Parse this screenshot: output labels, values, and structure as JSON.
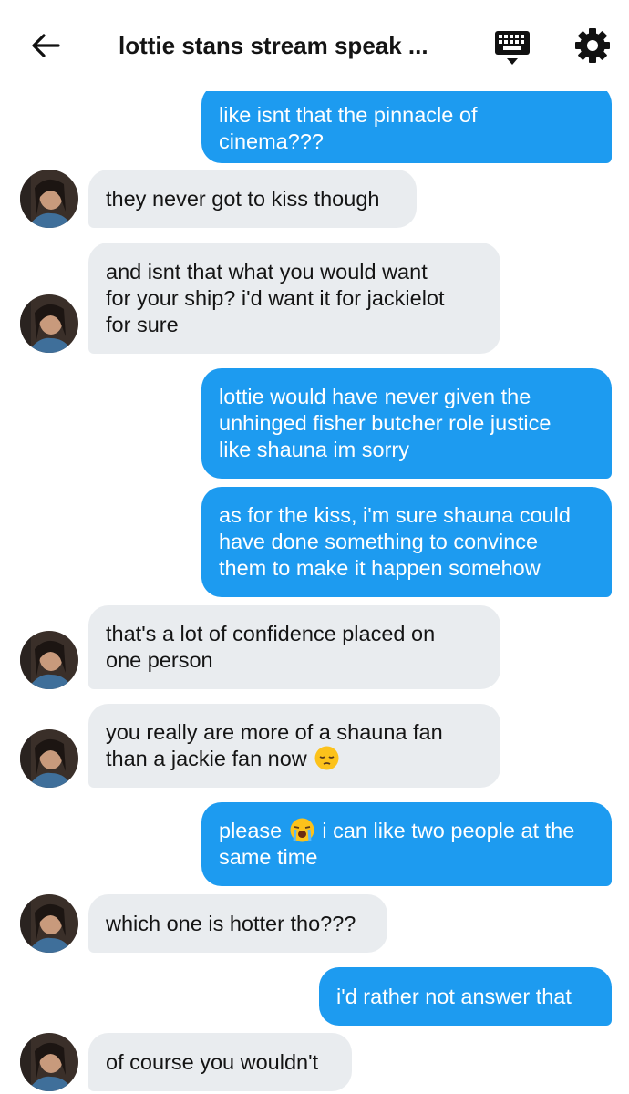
{
  "header": {
    "title": "lottie stans stream speak ...",
    "back_icon": "back-arrow-icon",
    "keyboard_icon": "keyboard-icon",
    "settings_icon": "gear-icon"
  },
  "colors": {
    "outgoing_bubble": "#1d9bf0",
    "incoming_bubble": "#e9ecef",
    "text_dark": "#141414"
  },
  "messages": [
    {
      "from": "me",
      "lines": [
        "like isnt that the pinnacle of",
        "cinema???"
      ]
    },
    {
      "from": "them",
      "lines": [
        "they never got to kiss though"
      ]
    },
    {
      "from": "them",
      "lines": [
        "and isnt that what you would want",
        "for your ship? i'd want it for jackielot",
        "for sure"
      ]
    },
    {
      "from": "me",
      "lines": [
        "lottie would have never given the",
        "unhinged fisher butcher role justice",
        "like shauna im sorry"
      ]
    },
    {
      "from": "me",
      "lines": [
        "as for the kiss, i'm sure shauna could",
        "have done something to convince",
        "them to make it happen somehow"
      ]
    },
    {
      "from": "them",
      "lines": [
        "that's a lot of confidence placed on",
        "one person"
      ]
    },
    {
      "from": "them",
      "lines": [
        "you really are more of a shauna fan",
        "than a jackie fan now"
      ],
      "emoji_end": "pensive-face-emoji"
    },
    {
      "from": "me",
      "lines": [
        "please",
        "i can like two people at the",
        "same time"
      ],
      "emoji_after_first": "loudly-crying-face-emoji"
    },
    {
      "from": "them",
      "lines": [
        "which one is hotter tho???"
      ]
    },
    {
      "from": "me",
      "lines": [
        "i'd rather not answer that"
      ]
    },
    {
      "from": "them",
      "lines": [
        "of course you wouldn't"
      ]
    }
  ]
}
